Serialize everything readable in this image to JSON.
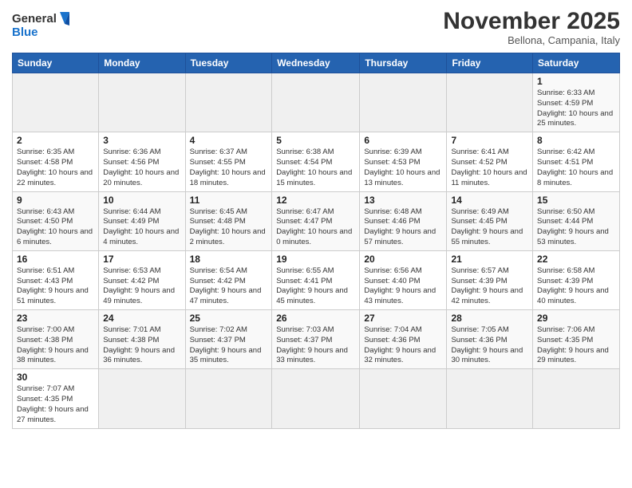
{
  "header": {
    "logo_general": "General",
    "logo_blue": "Blue",
    "month_title": "November 2025",
    "subtitle": "Bellona, Campania, Italy"
  },
  "weekdays": [
    "Sunday",
    "Monday",
    "Tuesday",
    "Wednesday",
    "Thursday",
    "Friday",
    "Saturday"
  ],
  "weeks": [
    [
      {
        "day": "",
        "info": ""
      },
      {
        "day": "",
        "info": ""
      },
      {
        "day": "",
        "info": ""
      },
      {
        "day": "",
        "info": ""
      },
      {
        "day": "",
        "info": ""
      },
      {
        "day": "",
        "info": ""
      },
      {
        "day": "1",
        "info": "Sunrise: 6:33 AM\nSunset: 4:59 PM\nDaylight: 10 hours\nand 25 minutes."
      }
    ],
    [
      {
        "day": "2",
        "info": "Sunrise: 6:35 AM\nSunset: 4:58 PM\nDaylight: 10 hours\nand 22 minutes."
      },
      {
        "day": "3",
        "info": "Sunrise: 6:36 AM\nSunset: 4:56 PM\nDaylight: 10 hours\nand 20 minutes."
      },
      {
        "day": "4",
        "info": "Sunrise: 6:37 AM\nSunset: 4:55 PM\nDaylight: 10 hours\nand 18 minutes."
      },
      {
        "day": "5",
        "info": "Sunrise: 6:38 AM\nSunset: 4:54 PM\nDaylight: 10 hours\nand 15 minutes."
      },
      {
        "day": "6",
        "info": "Sunrise: 6:39 AM\nSunset: 4:53 PM\nDaylight: 10 hours\nand 13 minutes."
      },
      {
        "day": "7",
        "info": "Sunrise: 6:41 AM\nSunset: 4:52 PM\nDaylight: 10 hours\nand 11 minutes."
      },
      {
        "day": "8",
        "info": "Sunrise: 6:42 AM\nSunset: 4:51 PM\nDaylight: 10 hours\nand 8 minutes."
      }
    ],
    [
      {
        "day": "9",
        "info": "Sunrise: 6:43 AM\nSunset: 4:50 PM\nDaylight: 10 hours\nand 6 minutes."
      },
      {
        "day": "10",
        "info": "Sunrise: 6:44 AM\nSunset: 4:49 PM\nDaylight: 10 hours\nand 4 minutes."
      },
      {
        "day": "11",
        "info": "Sunrise: 6:45 AM\nSunset: 4:48 PM\nDaylight: 10 hours\nand 2 minutes."
      },
      {
        "day": "12",
        "info": "Sunrise: 6:47 AM\nSunset: 4:47 PM\nDaylight: 10 hours\nand 0 minutes."
      },
      {
        "day": "13",
        "info": "Sunrise: 6:48 AM\nSunset: 4:46 PM\nDaylight: 9 hours\nand 57 minutes."
      },
      {
        "day": "14",
        "info": "Sunrise: 6:49 AM\nSunset: 4:45 PM\nDaylight: 9 hours\nand 55 minutes."
      },
      {
        "day": "15",
        "info": "Sunrise: 6:50 AM\nSunset: 4:44 PM\nDaylight: 9 hours\nand 53 minutes."
      }
    ],
    [
      {
        "day": "16",
        "info": "Sunrise: 6:51 AM\nSunset: 4:43 PM\nDaylight: 9 hours\nand 51 minutes."
      },
      {
        "day": "17",
        "info": "Sunrise: 6:53 AM\nSunset: 4:42 PM\nDaylight: 9 hours\nand 49 minutes."
      },
      {
        "day": "18",
        "info": "Sunrise: 6:54 AM\nSunset: 4:42 PM\nDaylight: 9 hours\nand 47 minutes."
      },
      {
        "day": "19",
        "info": "Sunrise: 6:55 AM\nSunset: 4:41 PM\nDaylight: 9 hours\nand 45 minutes."
      },
      {
        "day": "20",
        "info": "Sunrise: 6:56 AM\nSunset: 4:40 PM\nDaylight: 9 hours\nand 43 minutes."
      },
      {
        "day": "21",
        "info": "Sunrise: 6:57 AM\nSunset: 4:39 PM\nDaylight: 9 hours\nand 42 minutes."
      },
      {
        "day": "22",
        "info": "Sunrise: 6:58 AM\nSunset: 4:39 PM\nDaylight: 9 hours\nand 40 minutes."
      }
    ],
    [
      {
        "day": "23",
        "info": "Sunrise: 7:00 AM\nSunset: 4:38 PM\nDaylight: 9 hours\nand 38 minutes."
      },
      {
        "day": "24",
        "info": "Sunrise: 7:01 AM\nSunset: 4:38 PM\nDaylight: 9 hours\nand 36 minutes."
      },
      {
        "day": "25",
        "info": "Sunrise: 7:02 AM\nSunset: 4:37 PM\nDaylight: 9 hours\nand 35 minutes."
      },
      {
        "day": "26",
        "info": "Sunrise: 7:03 AM\nSunset: 4:37 PM\nDaylight: 9 hours\nand 33 minutes."
      },
      {
        "day": "27",
        "info": "Sunrise: 7:04 AM\nSunset: 4:36 PM\nDaylight: 9 hours\nand 32 minutes."
      },
      {
        "day": "28",
        "info": "Sunrise: 7:05 AM\nSunset: 4:36 PM\nDaylight: 9 hours\nand 30 minutes."
      },
      {
        "day": "29",
        "info": "Sunrise: 7:06 AM\nSunset: 4:35 PM\nDaylight: 9 hours\nand 29 minutes."
      }
    ],
    [
      {
        "day": "30",
        "info": "Sunrise: 7:07 AM\nSunset: 4:35 PM\nDaylight: 9 hours\nand 27 minutes."
      },
      {
        "day": "",
        "info": ""
      },
      {
        "day": "",
        "info": ""
      },
      {
        "day": "",
        "info": ""
      },
      {
        "day": "",
        "info": ""
      },
      {
        "day": "",
        "info": ""
      },
      {
        "day": "",
        "info": ""
      }
    ]
  ]
}
